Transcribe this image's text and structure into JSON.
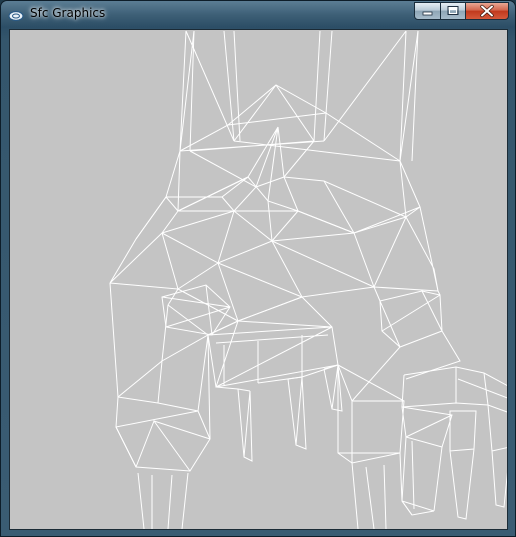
{
  "window": {
    "title": "Sfc Graphics",
    "icon": "app-icon",
    "controls": [
      "minimize-icon",
      "maximize-icon",
      "close-icon"
    ]
  },
  "canvas": {
    "background": "#c4c4c4",
    "stroke": "#ffffff",
    "render_mode": "wireframe"
  }
}
